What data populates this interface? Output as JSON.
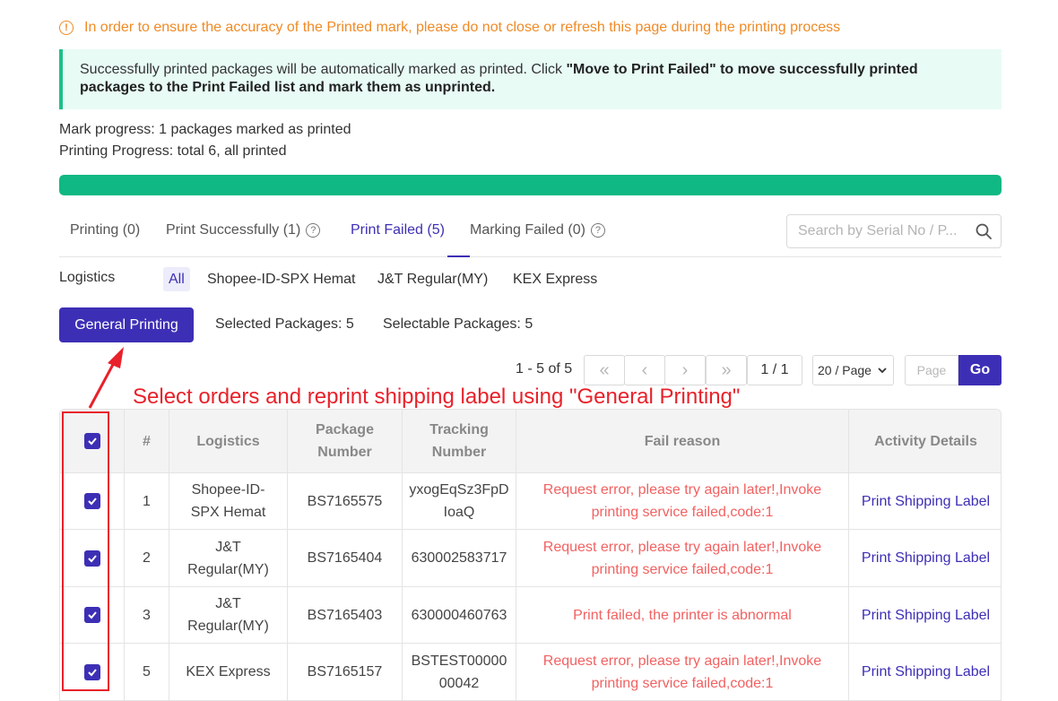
{
  "warning": {
    "icon": "alert-circle-icon",
    "text": "In order to ensure the accuracy of the Printed mark, please do not close or refresh this page during the printing process"
  },
  "info": {
    "text": "Successfully printed packages will be automatically marked as printed. Click ",
    "bold": "\"Move to Print Failed\" to move successfully printed packages to the Print Failed list and mark them as unprinted."
  },
  "progress": {
    "mark_text": "Mark progress: 1 packages marked as printed",
    "print_text": "Printing Progress: total 6, all printed",
    "percent": 100
  },
  "tabs": [
    {
      "label": "Printing (0)",
      "help": false
    },
    {
      "label": "Print Successfully (1)",
      "help": true
    },
    {
      "label": "Print Failed (5)",
      "help": false,
      "active": true
    },
    {
      "label": "Marking Failed (0)",
      "help": true
    }
  ],
  "search": {
    "placeholder": "Search by Serial No / P..."
  },
  "logistics": {
    "label": "Logistics",
    "options": [
      "All",
      "Shopee-ID-SPX Hemat",
      "J&T Regular(MY)",
      "KEX Express"
    ],
    "selected": "All"
  },
  "actions": {
    "general_printing": "General Printing",
    "selected_packages": "Selected Packages: 5",
    "selectable_packages": "Selectable Packages: 5"
  },
  "pagination": {
    "range": "1 - 5 of 5",
    "page": "1 / 1",
    "page_size": "20 / Page",
    "page_placeholder": "Page",
    "go": "Go"
  },
  "annotation": "Select orders and reprint shipping label using \"General Printing\"",
  "table": {
    "headers": [
      "#",
      "Logistics",
      "Package Number",
      "Tracking Number",
      "Fail reason",
      "Activity Details"
    ],
    "rows": [
      {
        "num": "1",
        "logistics": "Shopee-ID-SPX Hemat",
        "package": "BS7165575",
        "tracking": "yxogEqSz3FpDIoaQ",
        "reason": "Request error, please try again later!,Invoke printing service failed,code:1",
        "action": "Print Shipping Label",
        "checked": true
      },
      {
        "num": "2",
        "logistics": "J&T Regular(MY)",
        "package": "BS7165404",
        "tracking": "630002583717",
        "reason": "Request error, please try again later!,Invoke printing service failed,code:1",
        "action": "Print Shipping Label",
        "checked": true
      },
      {
        "num": "3",
        "logistics": "J&T Regular(MY)",
        "package": "BS7165403",
        "tracking": "630000460763",
        "reason": "Print failed, the printer is abnormal",
        "action": "Print Shipping Label",
        "checked": true
      },
      {
        "num": "5",
        "logistics": "KEX Express",
        "package": "BS7165157",
        "tracking": "BSTEST0000000042",
        "reason": "Request error, please try again later!,Invoke printing service failed,code:1",
        "action": "Print Shipping Label",
        "checked": true
      }
    ]
  },
  "colors": {
    "accent": "#3d2fb5",
    "success": "#10b883",
    "warning": "#f08a24",
    "error": "#f26161",
    "annotation": "#e8212a"
  }
}
